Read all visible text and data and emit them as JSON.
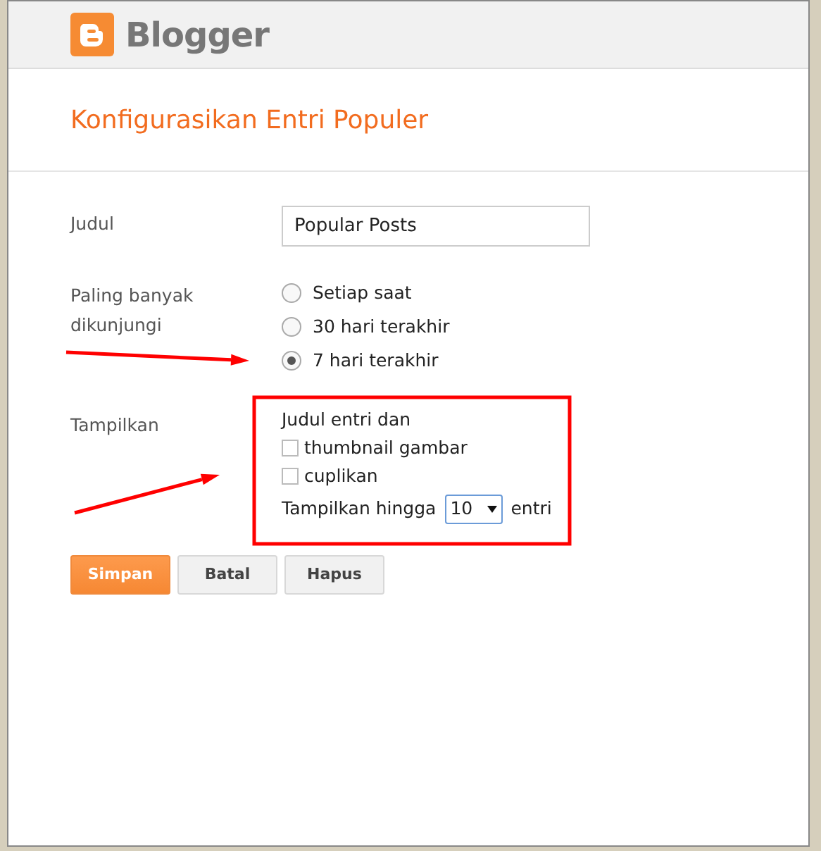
{
  "header": {
    "logo_text": "Blogger"
  },
  "title": "Konfigurasikan Entri Populer",
  "fields": [
    {
      "kind": "text",
      "label": "Judul",
      "value": "Popular Posts"
    },
    {
      "kind": "radio",
      "label": "Paling banyak dikunjungi",
      "options": [
        {
          "label": "Setiap saat",
          "selected": false
        },
        {
          "label": "30 hari terakhir",
          "selected": false
        },
        {
          "label": "7 hari terakhir",
          "selected": true
        }
      ]
    },
    {
      "kind": "display",
      "label": "Tampilkan",
      "intro": "Judul entri dan",
      "options": [
        {
          "label": "thumbnail gambar",
          "checked": false
        },
        {
          "label": "cuplikan",
          "checked": false
        }
      ],
      "limit_prefix": "Tampilkan hingga",
      "limit_value": "10",
      "limit_suffix": "entri"
    }
  ],
  "buttons": [
    {
      "label": "Simpan",
      "kind": "primary"
    },
    {
      "label": "Batal",
      "kind": "secondary"
    },
    {
      "label": "Hapus",
      "kind": "secondary"
    }
  ],
  "annotations": [
    {
      "kind": "arrow"
    },
    {
      "kind": "arrow"
    },
    {
      "kind": "box"
    }
  ]
}
